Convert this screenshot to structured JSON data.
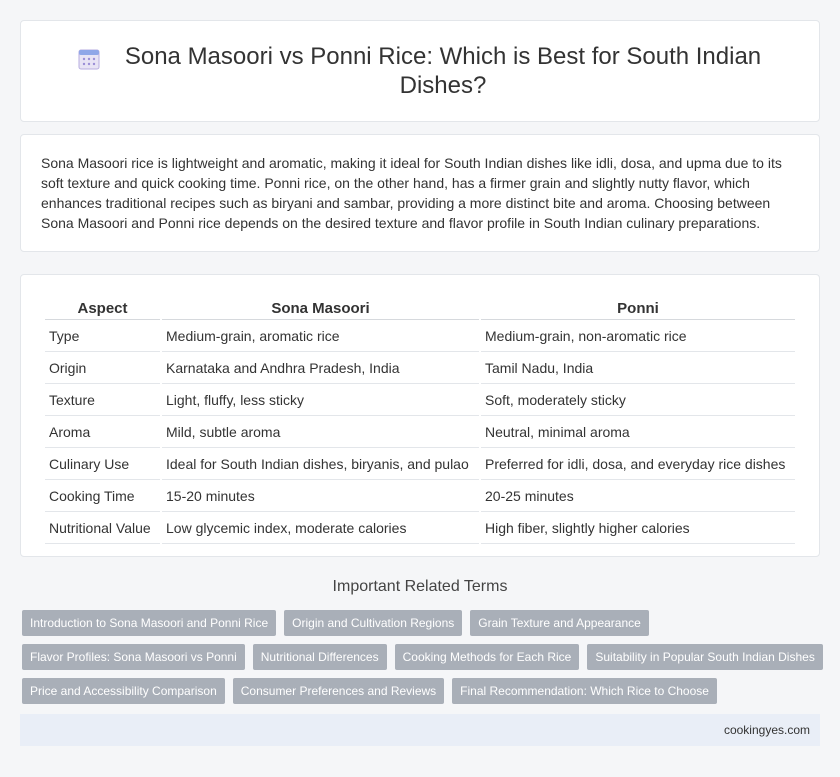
{
  "header": {
    "icon": "calendar-icon",
    "title": "Sona Masoori vs Ponni Rice: Which is Best for South Indian Dishes?"
  },
  "intro": {
    "text": "Sona Masoori rice is lightweight and aromatic, making it ideal for South Indian dishes like idli, dosa, and upma due to its soft texture and quick cooking time. Ponni rice, on the other hand, has a firmer grain and slightly nutty flavor, which enhances traditional recipes such as biryani and sambar, providing a more distinct bite and aroma. Choosing between Sona Masoori and Ponni rice depends on the desired texture and flavor profile in South Indian culinary preparations."
  },
  "table": {
    "headers": [
      "Aspect",
      "Sona Masoori",
      "Ponni"
    ],
    "rows": [
      [
        "Type",
        "Medium-grain, aromatic rice",
        "Medium-grain, non-aromatic rice"
      ],
      [
        "Origin",
        "Karnataka and Andhra Pradesh, India",
        "Tamil Nadu, India"
      ],
      [
        "Texture",
        "Light, fluffy, less sticky",
        "Soft, moderately sticky"
      ],
      [
        "Aroma",
        "Mild, subtle aroma",
        "Neutral, minimal aroma"
      ],
      [
        "Culinary Use",
        "Ideal for South Indian dishes, biryanis, and pulao",
        "Preferred for idli, dosa, and everyday rice dishes"
      ],
      [
        "Cooking Time",
        "15-20 minutes",
        "20-25 minutes"
      ],
      [
        "Nutritional Value",
        "Low glycemic index, moderate calories",
        "High fiber, slightly higher calories"
      ]
    ]
  },
  "related": {
    "heading": "Important Related Terms",
    "rows": [
      [
        "Introduction to Sona Masoori and Ponni Rice",
        "Origin and Cultivation Regions",
        "Grain Texture and Appearance"
      ],
      [
        "Flavor Profiles: Sona Masoori vs Ponni",
        "Nutritional Differences",
        "Cooking Methods for Each Rice",
        "Suitability in Popular South Indian Dishes"
      ],
      [
        "Price and Accessibility Comparison",
        "Consumer Preferences and Reviews",
        "Final Recommendation: Which Rice to Choose"
      ]
    ]
  },
  "footer": {
    "site": "cookingyes.com"
  },
  "colors": {
    "tag_background": "#a9afb8",
    "footer_background": "#e9eef7",
    "page_background": "#f5f6f8"
  }
}
